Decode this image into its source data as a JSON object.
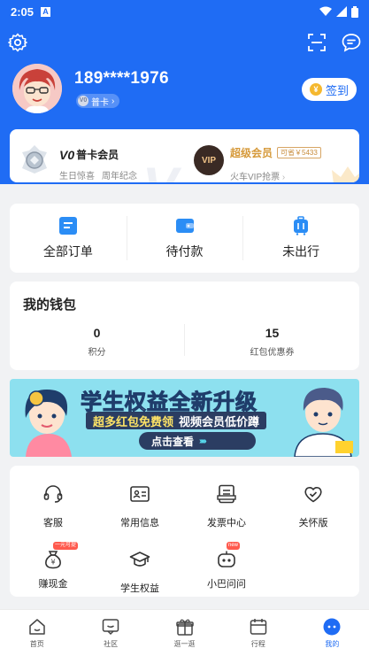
{
  "status_bar": {
    "time": "2:05",
    "notif_icon": "A"
  },
  "header": {
    "settings_icon": "gear-icon",
    "scan_icon": "scan-icon",
    "message_icon": "message-icon",
    "phone": "189****1976",
    "level_badge": {
      "icon_text": "V0",
      "label": "普卡"
    },
    "signin": {
      "coin": "¥",
      "label": "签到"
    }
  },
  "member": {
    "logo_text": "V0",
    "title": "普卡会员",
    "perks": [
      "生日惊喜",
      "周年纪念"
    ],
    "svip": {
      "icon_text": "VIP",
      "title": "超级会员",
      "save_tag": "可省￥5433",
      "subtitle": "火车VIP抢票"
    }
  },
  "orders": [
    {
      "label": "全部订单",
      "icon": "order-list-icon",
      "color": "#2b8df5"
    },
    {
      "label": "待付款",
      "icon": "wallet-icon",
      "color": "#2b8df5"
    },
    {
      "label": "未出行",
      "icon": "luggage-icon",
      "color": "#2b8df5"
    }
  ],
  "wallet": {
    "title": "我的钱包",
    "stats": [
      {
        "value": "0",
        "label": "积分"
      },
      {
        "value": "15",
        "label": "红包优惠券"
      }
    ]
  },
  "banner": {
    "title_a": "学生权益",
    "title_b": "全新升级",
    "sub_a": "超多红包免费领",
    "sub_b": "视频会员低价蹲",
    "button": "点击查看",
    "button_arrows": "›››››"
  },
  "services": {
    "row1": [
      {
        "label": "客服",
        "icon": "headset-icon"
      },
      {
        "label": "常用信息",
        "icon": "id-card-icon"
      },
      {
        "label": "发票中心",
        "icon": "invoice-icon"
      },
      {
        "label": "关怀版",
        "icon": "heart-icon"
      }
    ],
    "row2": [
      {
        "label": "赚现金",
        "icon": "money-bag-icon",
        "tag": "一元可提"
      },
      {
        "label": "学生权益",
        "icon": "graduation-cap-icon",
        "tag": ""
      },
      {
        "label": "小巴问问",
        "icon": "robot-icon",
        "tag": "new"
      }
    ]
  },
  "tabbar": [
    {
      "label": "首页",
      "icon": "home-icon",
      "active": false
    },
    {
      "label": "社区",
      "icon": "community-icon",
      "active": false
    },
    {
      "label": "逛一逛",
      "icon": "gift-icon",
      "active": false
    },
    {
      "label": "行程",
      "icon": "calendar-icon",
      "active": false
    },
    {
      "label": "我的",
      "icon": "profile-icon",
      "active": true
    }
  ],
  "colors": {
    "primary": "#1f6cf4",
    "gold": "#d69a3b",
    "background": "#f1f2f4"
  }
}
